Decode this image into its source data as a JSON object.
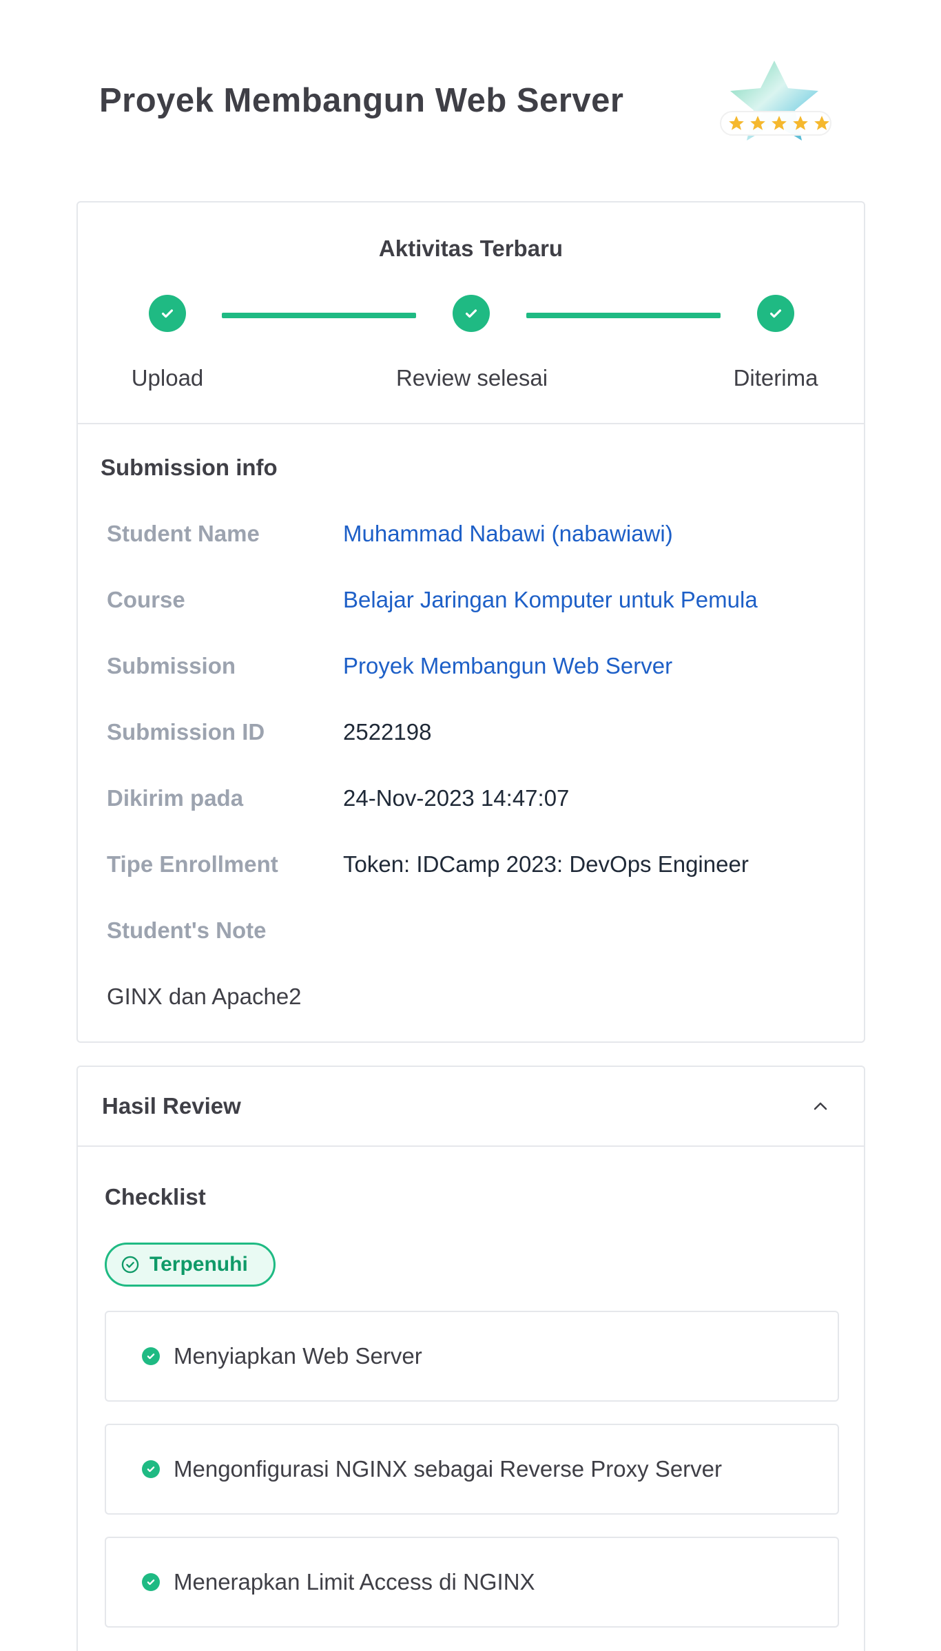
{
  "header": {
    "title": "Proyek Membangun Web Server",
    "badge_icon": "rating-star-badge-icon",
    "rating_stars": 5
  },
  "activity": {
    "title": "Aktivitas Terbaru",
    "steps": [
      {
        "label": "Upload",
        "status": "done"
      },
      {
        "label": "Review selesai",
        "status": "done"
      },
      {
        "label": "Diterima",
        "status": "done"
      }
    ],
    "accent_color": "#1fba83"
  },
  "submission_info": {
    "heading": "Submission info",
    "rows": [
      {
        "label": "Student Name",
        "value": "Muhammad Nabawi (nabawiawi)",
        "link": true
      },
      {
        "label": "Course",
        "value": "Belajar Jaringan Komputer untuk Pemula",
        "link": true
      },
      {
        "label": "Submission",
        "value": "Proyek Membangun Web Server",
        "link": true
      },
      {
        "label": "Submission ID",
        "value": "2522198",
        "link": false
      },
      {
        "label": "Dikirim pada",
        "value": "24-Nov-2023 14:47:07",
        "link": false
      },
      {
        "label": "Tipe Enrollment",
        "value": "Token: IDCamp 2023: DevOps Engineer",
        "link": false
      },
      {
        "label": "Student's Note",
        "value": "",
        "link": false
      }
    ],
    "student_note": "GINX dan Apache2",
    "link_color": "#1d5fc7"
  },
  "review": {
    "title": "Hasil Review",
    "checklist_heading": "Checklist",
    "status_label": "Terpenuhi",
    "items": [
      {
        "label": "Menyiapkan Web Server"
      },
      {
        "label": "Mengonfigurasi NGINX sebagai Reverse Proxy Server"
      },
      {
        "label": "Menerapkan Limit Access di NGINX"
      }
    ]
  }
}
